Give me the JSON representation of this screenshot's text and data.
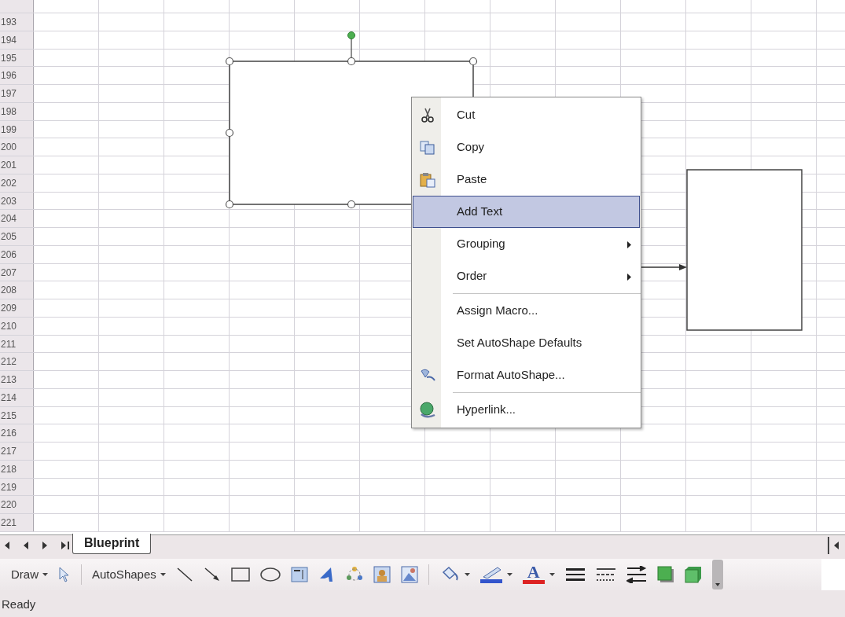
{
  "sheet": {
    "row_headers": [
      "193",
      "194",
      "195",
      "196",
      "197",
      "198",
      "199",
      "200",
      "201",
      "202",
      "203",
      "204",
      "205",
      "206",
      "207",
      "208",
      "209",
      "210",
      "211",
      "212",
      "213",
      "214",
      "215",
      "216",
      "217",
      "218",
      "219",
      "220",
      "221"
    ]
  },
  "shapes": [
    {
      "kind": "rectangle",
      "selected": true
    },
    {
      "kind": "rectangle",
      "selected": false
    },
    {
      "kind": "arrow",
      "selected": false
    }
  ],
  "context_menu": {
    "items": [
      {
        "kind": "command",
        "label": "Cut",
        "selected": false
      },
      {
        "kind": "command",
        "label": "Copy",
        "selected": false
      },
      {
        "kind": "command",
        "label": "Paste",
        "selected": false
      },
      {
        "kind": "command",
        "label": "Add Text",
        "selected": true
      },
      {
        "kind": "submenu",
        "label": "Grouping",
        "selected": false
      },
      {
        "kind": "submenu",
        "label": "Order",
        "selected": false
      },
      {
        "kind": "separator"
      },
      {
        "kind": "command",
        "label": "Assign Macro...",
        "selected": false
      },
      {
        "kind": "command",
        "label": "Set AutoShape Defaults",
        "selected": false
      },
      {
        "kind": "command",
        "label": "Format AutoShape...",
        "selected": false
      },
      {
        "kind": "separator"
      },
      {
        "kind": "command",
        "label": "Hyperlink...",
        "selected": false
      }
    ]
  },
  "sheet_tabs": [
    {
      "label": "Blueprint",
      "selected": true
    }
  ],
  "drawing_toolbar": [
    {
      "kind": "menu",
      "label": "Draw"
    },
    {
      "kind": "tool"
    },
    {
      "kind": "separator"
    },
    {
      "kind": "menu",
      "label": "AutoShapes"
    },
    {
      "kind": "tool"
    },
    {
      "kind": "tool"
    },
    {
      "kind": "tool"
    },
    {
      "kind": "tool"
    },
    {
      "kind": "tool"
    },
    {
      "kind": "tool"
    },
    {
      "kind": "tool"
    },
    {
      "kind": "tool"
    },
    {
      "kind": "tool"
    },
    {
      "kind": "separator"
    },
    {
      "kind": "color-dropdown"
    },
    {
      "kind": "color-dropdown",
      "color": "#3355cc"
    },
    {
      "kind": "color-dropdown",
      "color": "#dd2222",
      "label": "A"
    },
    {
      "kind": "tool"
    },
    {
      "kind": "tool"
    },
    {
      "kind": "tool"
    },
    {
      "kind": "tool"
    },
    {
      "kind": "tool"
    }
  ],
  "status_bar": {
    "text": "Ready"
  }
}
